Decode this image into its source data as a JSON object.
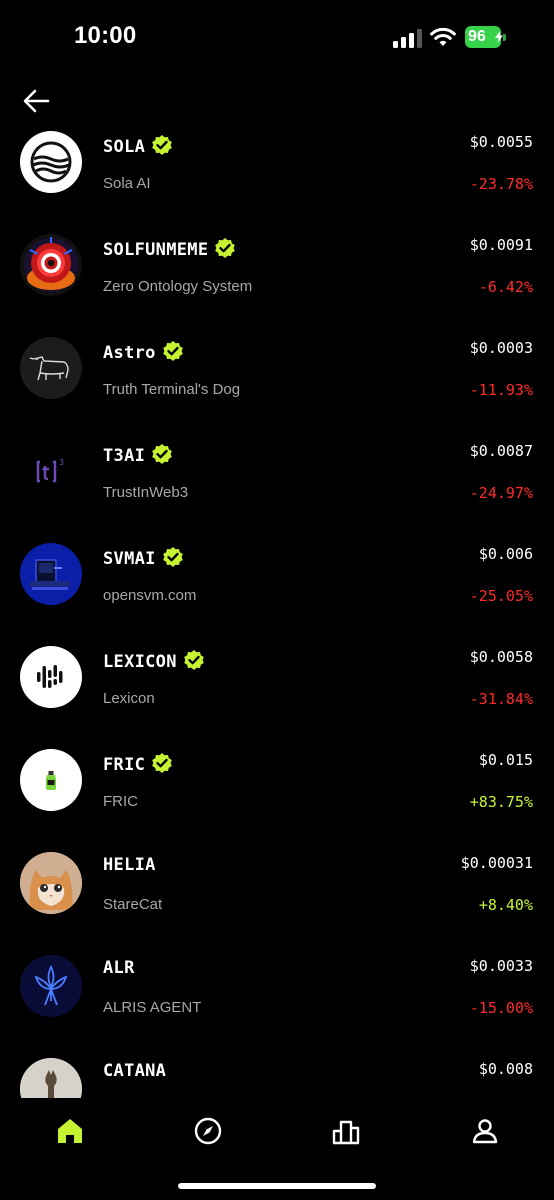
{
  "status_bar": {
    "time": "10:00",
    "battery": "96"
  },
  "colors": {
    "accent": "#c6f432",
    "negative": "#ff2b2b",
    "positive": "#c6f432",
    "muted": "#a8a8a8"
  },
  "tokens": [
    {
      "symbol": "SOLA",
      "verified": true,
      "name": "Sola AI",
      "price": "$0.0055",
      "change": "-23.78%",
      "direction": "down",
      "avatar_icon": "sola-wave-logo"
    },
    {
      "symbol": "SOLFUNMEME",
      "verified": true,
      "name": "Zero Ontology System",
      "price": "$0.0091",
      "change": "-6.42%",
      "direction": "down",
      "avatar_icon": "red-eye-logo"
    },
    {
      "symbol": "Astro",
      "verified": true,
      "name": "Truth Terminal's Dog",
      "price": "$0.0003",
      "change": "-11.93%",
      "direction": "down",
      "avatar_icon": "dog-sketch-logo"
    },
    {
      "symbol": "T3AI",
      "verified": true,
      "name": "TrustInWeb3",
      "price": "$0.0087",
      "change": "-24.97%",
      "direction": "down",
      "avatar_icon": "t3-logo"
    },
    {
      "symbol": "SVMAI",
      "verified": true,
      "name": "opensvm.com",
      "price": "$0.006",
      "change": "-25.05%",
      "direction": "down",
      "avatar_icon": "svm-logo"
    },
    {
      "symbol": "LEXICON",
      "verified": true,
      "name": "Lexicon",
      "price": "$0.0058",
      "change": "-31.84%",
      "direction": "down",
      "avatar_icon": "soundwave-logo"
    },
    {
      "symbol": "FRIC",
      "verified": true,
      "name": "FRIC",
      "price": "$0.015",
      "change": "+83.75%",
      "direction": "up",
      "avatar_icon": "fric-bottle-logo"
    },
    {
      "symbol": "HELIA",
      "verified": false,
      "name": "StareCat",
      "price": "$0.00031",
      "change": "+8.40%",
      "direction": "up",
      "avatar_icon": "cat-photo"
    },
    {
      "symbol": "ALR",
      "verified": false,
      "name": "ALRIS AGENT",
      "price": "$0.0033",
      "change": "-15.00%",
      "direction": "down",
      "avatar_icon": "blue-iris-logo"
    },
    {
      "symbol": "CATANA",
      "verified": false,
      "name": "",
      "price": "$0.008",
      "change": "",
      "direction": "none",
      "avatar_icon": "cat-figure-photo"
    }
  ],
  "nav": [
    {
      "id": "home",
      "icon": "home-icon",
      "active": true
    },
    {
      "id": "explore",
      "icon": "compass-icon",
      "active": false
    },
    {
      "id": "leaderboard",
      "icon": "podium-icon",
      "active": false
    },
    {
      "id": "profile",
      "icon": "user-icon",
      "active": false
    }
  ]
}
